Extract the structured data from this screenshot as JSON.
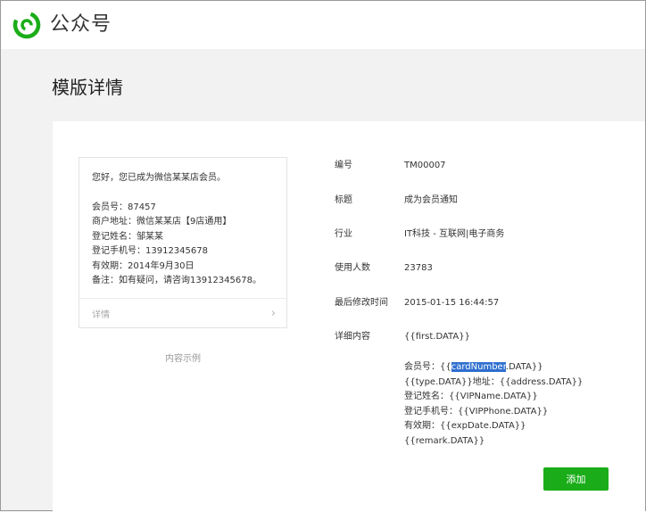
{
  "brand": "公众号",
  "page_title": "模版详情",
  "preview": {
    "greeting": "您好，您已成为微信某某店会员。",
    "lines": [
      "会员号：87457",
      "商户地址：微信某某店【9店通用】",
      "登记姓名：邹某某",
      "登记手机号：13912345678",
      "有效期：2014年9月30日",
      "备注：如有疑问，请咨询13912345678。"
    ],
    "detail_link": "详情",
    "caption": "内容示例"
  },
  "fields": {
    "id_label": "编号",
    "id_value": "TM00007",
    "title_label": "标题",
    "title_value": "成为会员通知",
    "industry_label": "行业",
    "industry_value": "IT科技 - 互联网|电子商务",
    "users_label": "使用人数",
    "users_value": "23783",
    "modified_label": "最后修改时间",
    "modified_value": "2015-01-15 16:44:57",
    "content_label": "详细内容",
    "content_first": "{{first.DATA}}"
  },
  "content": {
    "l1_prefix": "会员号：{{",
    "l1_highlight": "cardNumber",
    "l1_suffix": ".DATA}}",
    "l2": "{{type.DATA}}地址：{{address.DATA}}",
    "l3": "登记姓名：{{VIPName.DATA}}",
    "l4": "登记手机号：{{VIPPhone.DATA}}",
    "l5": "有效期：{{expDate.DATA}}",
    "l6": "{{remark.DATA}}"
  },
  "add_button": "添加",
  "colors": {
    "brand_green": "#1aad19",
    "selection_blue": "#2f6fcf"
  }
}
